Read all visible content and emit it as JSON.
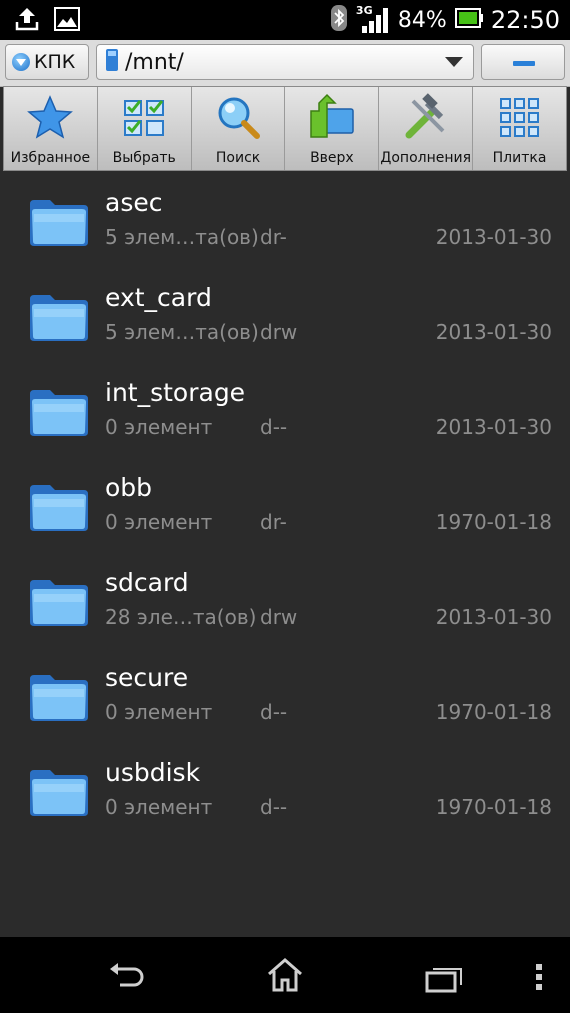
{
  "status": {
    "network": "3G",
    "battery": "84%",
    "time": "22:50"
  },
  "pathbar": {
    "device": "КПК",
    "path": "/mnt/"
  },
  "toolbar": [
    {
      "label": "Избранное",
      "icon": "star-icon"
    },
    {
      "label": "Выбрать",
      "icon": "checklist-icon"
    },
    {
      "label": "Поиск",
      "icon": "search-icon"
    },
    {
      "label": "Вверх",
      "icon": "folder-up-icon"
    },
    {
      "label": "Дополнения",
      "icon": "tools-icon"
    },
    {
      "label": "Плитка",
      "icon": "grid-icon"
    }
  ],
  "files": [
    {
      "name": "asec",
      "items": "5 элем…та(ов)",
      "perm": "dr-",
      "date": "2013-01-30"
    },
    {
      "name": "ext_card",
      "items": "5 элем…та(ов)",
      "perm": "drw",
      "date": "2013-01-30"
    },
    {
      "name": "int_storage",
      "items": "0 элемент",
      "perm": "d--",
      "date": "2013-01-30"
    },
    {
      "name": "obb",
      "items": "0 элемент",
      "perm": "dr-",
      "date": "1970-01-18"
    },
    {
      "name": "sdcard",
      "items": "28 эле…та(ов)",
      "perm": "drw",
      "date": "2013-01-30"
    },
    {
      "name": "secure",
      "items": "0 элемент",
      "perm": "d--",
      "date": "1970-01-18"
    },
    {
      "name": "usbdisk",
      "items": "0 элемент",
      "perm": "d--",
      "date": "1970-01-18"
    }
  ]
}
